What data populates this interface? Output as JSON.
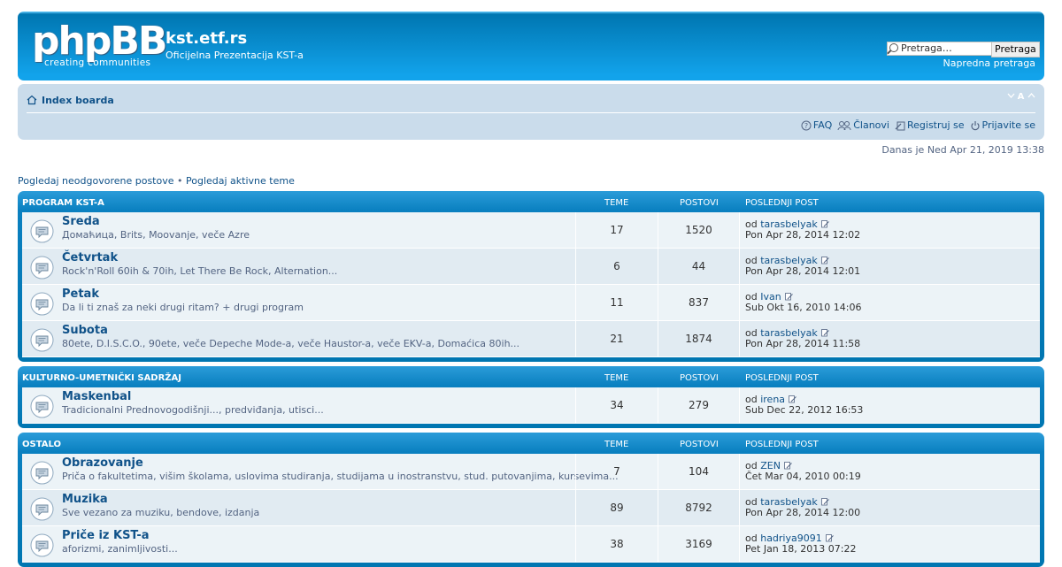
{
  "header": {
    "logo_main": "phpBB",
    "logo_tagline": "creating  communities",
    "site_title": "kst.etf.rs",
    "site_description": "Oficijelna Prezentacija KST-a",
    "search_placeholder": "Pretraga…",
    "search_button": "Pretraga",
    "advanced_search": "Napredna pretraga"
  },
  "navbar": {
    "index_label": "Index boarda",
    "font_size_control": "A",
    "links": {
      "faq": "FAQ",
      "members": "Članovi",
      "register": "Registruj se",
      "login": "Prijavite se"
    }
  },
  "date_line": "Danas je Ned Apr 21, 2019 13:38",
  "quick_links": {
    "unanswered": "Pogledaj neodgovorene postove",
    "separator": " • ",
    "active": "Pogledaj aktivne teme"
  },
  "columns": {
    "topics": "TEME",
    "posts": "POSTOVI",
    "last_post": "POSLEDNJI POST",
    "by_prefix": "od"
  },
  "categories": [
    {
      "name": "PROGRAM KST-A",
      "forums": [
        {
          "title": "Sreda",
          "desc": "Домаћица, Brits, Moovanje, veče Azre",
          "topics": "17",
          "posts": "1520",
          "author": "tarasbelyak",
          "date": "Pon Apr 28, 2014 12:02"
        },
        {
          "title": "Četvrtak",
          "desc": "Rock'n'Roll 60ih & 70ih, Let There Be Rock, Alternation...",
          "topics": "6",
          "posts": "44",
          "author": "tarasbelyak",
          "date": "Pon Apr 28, 2014 12:01"
        },
        {
          "title": "Petak",
          "desc": "Da li ti znaš za neki drugi ritam? + drugi program",
          "topics": "11",
          "posts": "837",
          "author": "Ivan",
          "date": "Sub Okt 16, 2010 14:06"
        },
        {
          "title": "Subota",
          "desc": "80ete, D.I.S.C.O., 90ete, veče Depeche Mode-a, veče Haustor-a, veče EKV-a, Domaćica 80ih...",
          "topics": "21",
          "posts": "1874",
          "author": "tarasbelyak",
          "date": "Pon Apr 28, 2014 11:58"
        }
      ]
    },
    {
      "name": "KULTURNO-UMETNIČKI SADRŽAJ",
      "forums": [
        {
          "title": "Maskenbal",
          "desc": "Tradicionalni Prednovogodišnji..., predviđanja, utisci...",
          "topics": "34",
          "posts": "279",
          "author": "irena",
          "date": "Sub Dec 22, 2012 16:53"
        }
      ]
    },
    {
      "name": "OSTALO",
      "forums": [
        {
          "title": "Obrazovanje",
          "desc": "Priča o fakultetima, višim školama, uslovima studiranja, studijama u inostranstvu, stud. putovanjima, kursevima...",
          "topics": "7",
          "posts": "104",
          "author": "ZEN",
          "date": "Čet Mar 04, 2010 00:19"
        },
        {
          "title": "Muzika",
          "desc": "Sve vezano za muziku, bendove, izdanja",
          "topics": "89",
          "posts": "8792",
          "author": "tarasbelyak",
          "date": "Pon Apr 28, 2014 12:00"
        },
        {
          "title": "Priče iz KST-a",
          "desc": "aforizmi, zanimljivosti...",
          "topics": "38",
          "posts": "3169",
          "author": "hadriya9091",
          "date": "Pet Jan 18, 2013 07:22"
        }
      ]
    }
  ],
  "colors": {
    "header_blue": "#12a3eb",
    "navbar_bg": "#cadceb",
    "link": "#105289",
    "row_light": "#ecf3f7",
    "row_alt": "#e1ebf2"
  }
}
